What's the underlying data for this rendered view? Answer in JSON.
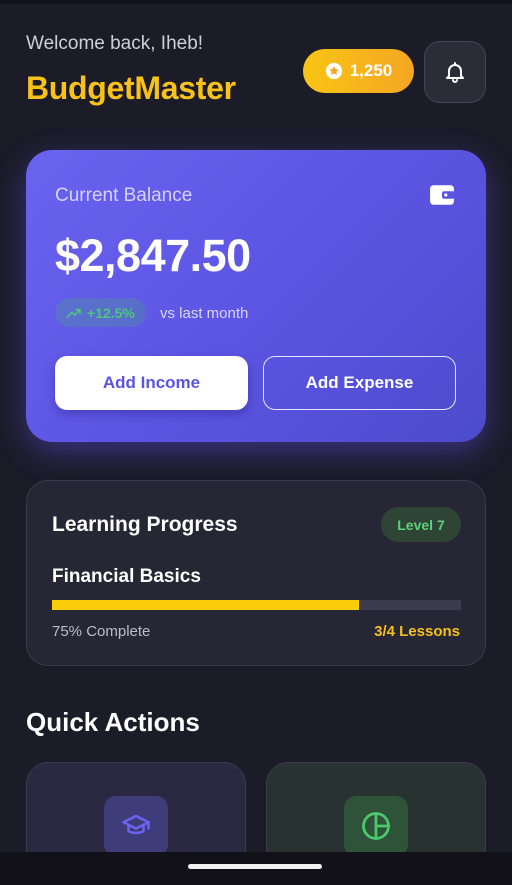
{
  "header": {
    "welcome": "Welcome back, Iheb!",
    "brand": "BudgetMaster",
    "coins": "1,250"
  },
  "balance_card": {
    "label": "Current Balance",
    "amount": "$2,847.50",
    "trend": "+12.5%",
    "trend_note": "vs last month",
    "add_income": "Add Income",
    "add_expense": "Add Expense"
  },
  "learning": {
    "title": "Learning Progress",
    "level": "Level 7",
    "course": "Financial Basics",
    "progress_fraction": 0.75,
    "percent_text": "75% Complete",
    "lessons_text": "3/4 Lessons"
  },
  "quick_actions": {
    "title": "Quick Actions",
    "items": [
      {
        "icon": "graduation-cap-icon",
        "color": "#6b63f2"
      },
      {
        "icon": "pie-chart-icon",
        "color": "#4cc96e"
      }
    ]
  },
  "colors": {
    "brand": "#f8c21a",
    "accent": "#5b54e2",
    "success": "#4cc47e",
    "progress": "#f9cd0a"
  }
}
